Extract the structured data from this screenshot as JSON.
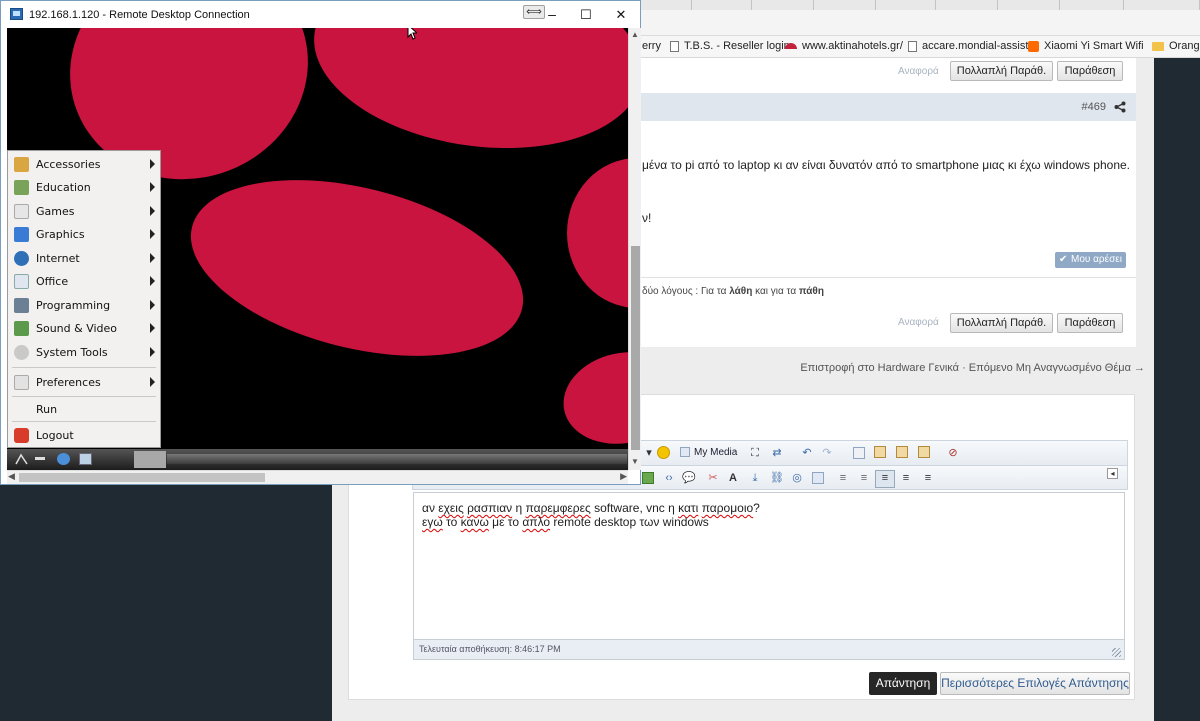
{
  "rdp": {
    "title": "192.168.1.120 - Remote Desktop Connection",
    "connbar_glyph": "⟺",
    "minimize": "–",
    "maximize": "☐",
    "close": "✕"
  },
  "start_menu": {
    "items": [
      {
        "label": "Accessories",
        "icon": "accessories-icon",
        "color": "#d9a641"
      },
      {
        "label": "Education",
        "icon": "education-icon",
        "color": "#7aa35a"
      },
      {
        "label": "Games",
        "icon": "games-icon",
        "color": "#c94a4a"
      },
      {
        "label": "Graphics",
        "icon": "graphics-icon",
        "color": "#3a7bd5"
      },
      {
        "label": "Internet",
        "icon": "internet-icon",
        "color": "#2f6fb7"
      },
      {
        "label": "Office",
        "icon": "office-icon",
        "color": "#6a8fb7"
      },
      {
        "label": "Programming",
        "icon": "programming-icon",
        "color": "#8a8a8a"
      },
      {
        "label": "Sound & Video",
        "icon": "sound-video-icon",
        "color": "#5a9a4a"
      },
      {
        "label": "System Tools",
        "icon": "system-tools-icon",
        "color": "#9a9a9a"
      }
    ],
    "preferences": "Preferences",
    "run": "Run",
    "logout": "Logout"
  },
  "browser": {
    "bookmarks": [
      {
        "label": "erry",
        "icon": "none"
      },
      {
        "label": "T.B.S. - Reseller login",
        "icon": "doc"
      },
      {
        "label": "www.aktinahotels.gr/",
        "icon": "aktina"
      },
      {
        "label": "accare.mondial-assist",
        "icon": "doc"
      },
      {
        "label": "Xiaomi Yi Smart Wifi",
        "icon": "mi"
      },
      {
        "label": "Orange",
        "icon": "folder"
      }
    ]
  },
  "forum": {
    "report_link": "Αναφορά",
    "multi_quote": "Πολλαπλή Παράθ.",
    "quote": "Παράθεση",
    "post_number": "#469",
    "post_line1": "μένα το pi από το laptop κι αν είναι δυνατόν από το smartphone μιας κι έχω windows phone.",
    "post_line2": "ν!",
    "like": "Μου αρέσει",
    "signature_pre": "δύο λόγους : Για τα ",
    "signature_b1": "λάθη",
    "signature_mid": " και για τα ",
    "signature_b2": "πάθη",
    "report_link2": "Αναφορά",
    "nav": "Επιστροφή στο Hardware Γενικά · Επόμενο Μη Αναγνωσμένο Θέμα →",
    "my_media": "My Media",
    "editor_line1": {
      "w1": "αν",
      "w2": "εχεις",
      "w3": "ρασπιαν",
      "w4": "η",
      "w5": "παρεμφερες",
      "w6": "software, vnc η",
      "w7": "κατι",
      "w8": "παρομοιο",
      "w9": "?"
    },
    "editor_line2": {
      "w1": "εγω",
      "w2": "το",
      "w3": "κανω",
      "w4": "με το",
      "w5": "απλο",
      "w6": "remote desktop των windows"
    },
    "last_saved": "Τελευταία αποθήκευση: 8:46:17 PM",
    "reply": "Απάντηση",
    "more_options": "Περισσότερες Επιλογές Απάντησης"
  },
  "colors": {
    "desktop_blob": "#c8143f",
    "reply_button": "#262626"
  }
}
